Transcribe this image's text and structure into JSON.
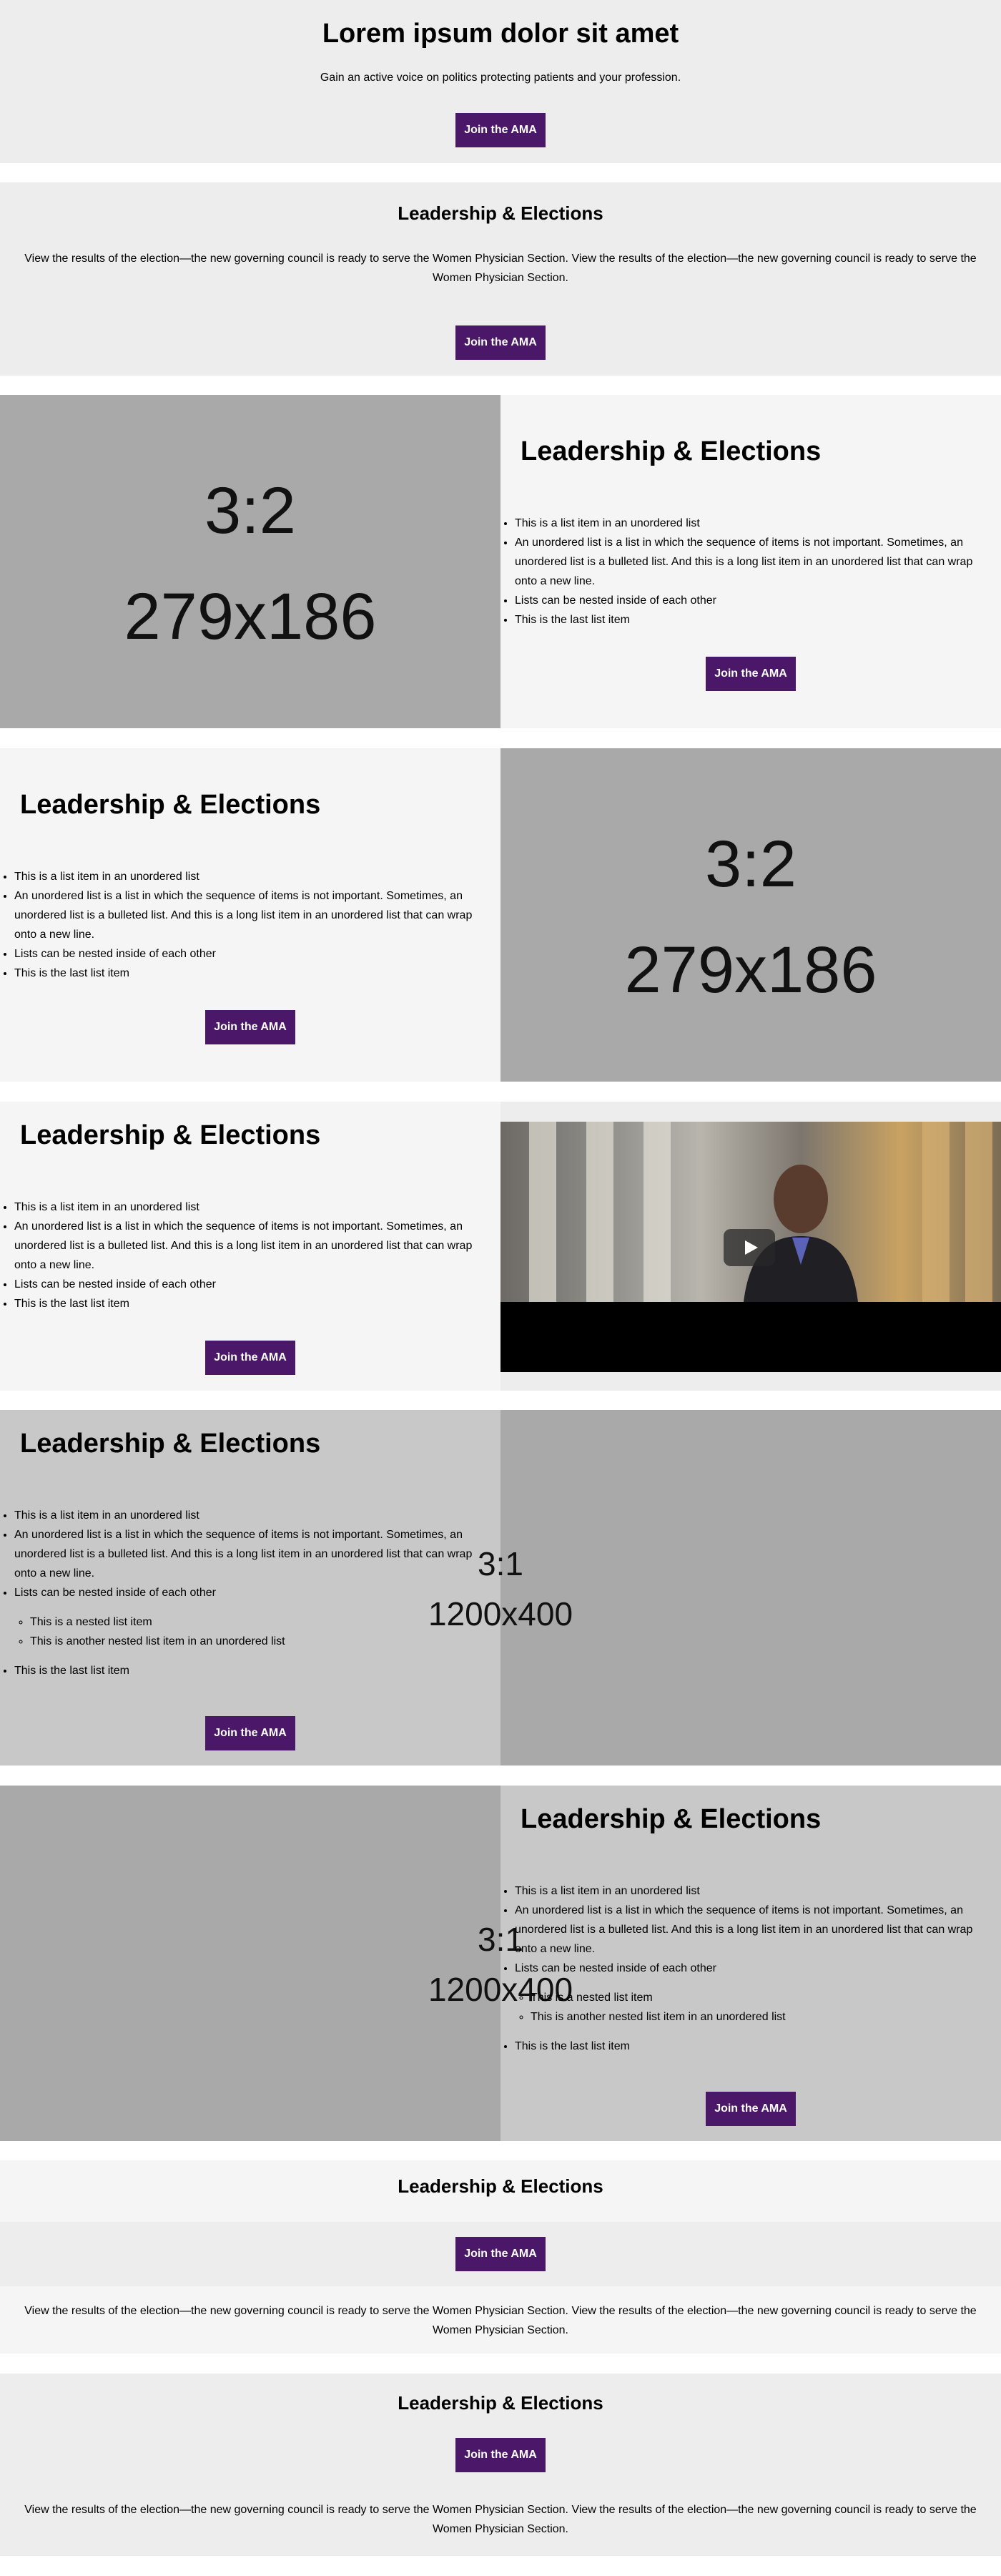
{
  "hero": {
    "title": "Lorem ipsum dolor sit amet",
    "subtitle": "Gain an active voice on politics protecting patients and your profession.",
    "button": "Join the AMA"
  },
  "cta1": {
    "title": "Leadership & Elections",
    "text": "View the results of the election—the new governing council is ready to serve the Women Physician Section. View the results of the election—the new governing council is ready to serve the Women Physician Section.",
    "button": "Join the AMA"
  },
  "placeholder_3x2": {
    "ratio": "3:2",
    "size": "279x186"
  },
  "placeholder_3x1": {
    "ratio": "3:1",
    "size": "1200x400"
  },
  "card_title": "Leadership & Elections",
  "list_items": [
    "This is a list item in an unordered list",
    "An unordered list is a list in which the sequence of items is not important. Sometimes, an unordered list is a bulleted list. And this is a long list item in an unordered list that can wrap onto a new line.",
    "Lists can be nested inside of each other",
    "This is the last list item"
  ],
  "nested_items": [
    "This is a nested list item",
    "This is another nested list item in an unordered list"
  ],
  "button_label": "Join the AMA",
  "cta2": {
    "title": "Leadership & Elections",
    "button": "Join the AMA",
    "text": "View the results of the election—the new governing council is ready to serve the Women Physician Section. View the results of the election—the new governing council is ready to serve the Women Physician Section."
  },
  "cta3": {
    "title": "Leadership & Elections",
    "button": "Join the AMA",
    "text": "View the results of the election—the new governing council is ready to serve the Women Physician Section. View the results of the election—the new governing council is ready to serve the Women Physician Section."
  },
  "colors": {
    "button_bg": "#4a1769",
    "section_gray": "#ededed",
    "section_light": "#f5f5f5",
    "placeholder_gray": "#a9a9a9"
  },
  "icons": [
    "play-icon"
  ]
}
